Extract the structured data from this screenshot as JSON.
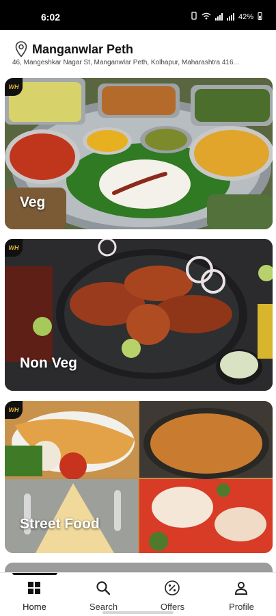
{
  "status_bar": {
    "time": "6:02",
    "battery": "42%",
    "icons": [
      "vibrate-icon",
      "wifi-icon",
      "signal-icon",
      "battery-icon"
    ]
  },
  "location": {
    "title": "Manganwlar Peth",
    "address": "46, Mangeshkar Nagar St, Manganwlar Peth, Kolhapur, Maharashtra 416..."
  },
  "categories": [
    {
      "label": "Veg",
      "badge": "WH"
    },
    {
      "label": "Non Veg",
      "badge": "WH"
    },
    {
      "label": "Street Food",
      "badge": "WH"
    }
  ],
  "nav": {
    "items": [
      {
        "label": "Home",
        "icon": "home-grid-icon",
        "active": true
      },
      {
        "label": "Search",
        "icon": "search-icon",
        "active": false
      },
      {
        "label": "Offers",
        "icon": "percent-badge-icon",
        "active": false
      },
      {
        "label": "Profile",
        "icon": "profile-icon",
        "active": false
      }
    ]
  },
  "colors": {
    "status_bar_bg": "#000000",
    "badge_gold": "#e0b23a",
    "active_nav": "#111111"
  }
}
